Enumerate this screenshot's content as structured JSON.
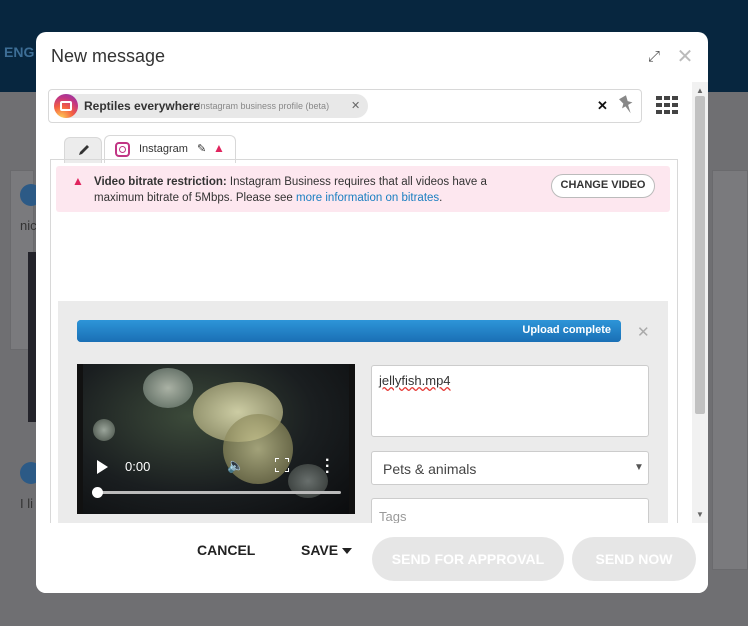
{
  "background": {
    "brand_fragment": "ENG",
    "post_snippet_1": "nic",
    "post_snippet_2": "I li"
  },
  "modal": {
    "title": "New message",
    "expand_icon": "expand-icon",
    "close_icon": "close-icon"
  },
  "profiles": {
    "chip_name": "Reptiles everywhere",
    "chip_type": "Instagram business profile (beta)",
    "remove_symbol": "✕",
    "clear_symbol": "✕"
  },
  "tabs": {
    "instagram_label": "Instagram"
  },
  "alert": {
    "heading": "Video bitrate restriction:",
    "text": " Instagram Business requires that all videos have a maximum bitrate of 5Mbps. Please see ",
    "link": "more information on bitrates",
    "end": ".",
    "button": "CHANGE VIDEO"
  },
  "upload": {
    "status": "Upload complete",
    "progress": 1.0
  },
  "video": {
    "time": "0:00"
  },
  "fields": {
    "title_value": "jellyfish.mp4",
    "category_value": "Pets & animals",
    "tags_placeholder": "Tags"
  },
  "footer": {
    "cancel": "CANCEL",
    "save": "SAVE",
    "send_for_approval": "SEND FOR APPROVAL",
    "send_now": "SEND NOW"
  },
  "colors": {
    "progress": "#1e7bc4",
    "alert_bg": "#fde7ef",
    "warning": "#e0245e",
    "link": "#1a7fc1",
    "disabled_button": "#e6e6e6"
  }
}
